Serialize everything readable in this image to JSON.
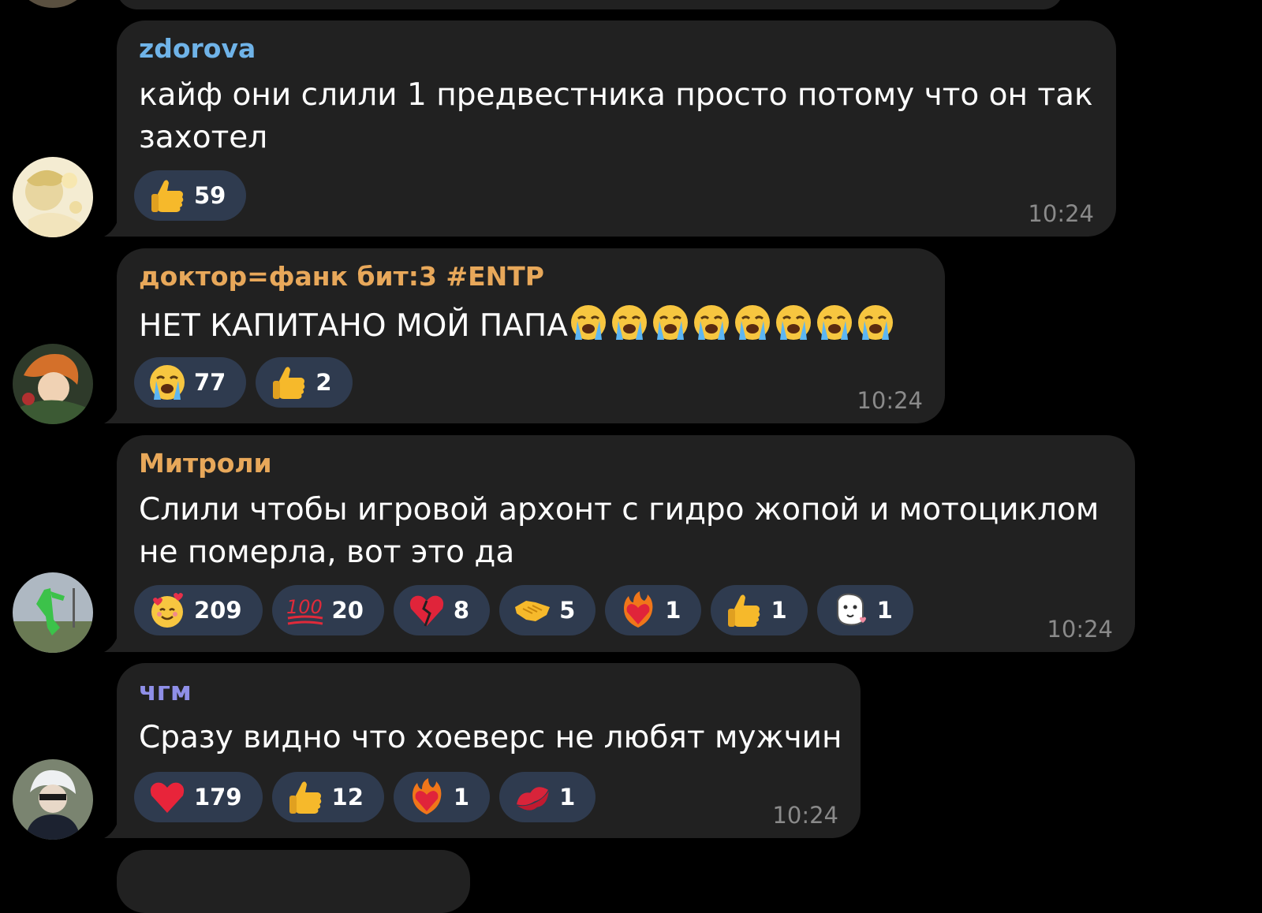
{
  "messages": [
    {
      "author": "zdorova",
      "author_color": "#6fb3e8",
      "lines": [
        "кайф они слили 1 предвестника просто потому что он так",
        "захотел"
      ],
      "reactions": [
        {
          "icon": "thumbs-up-icon",
          "count": "59"
        }
      ],
      "time": "10:24"
    },
    {
      "author": "доктор=фанк бит:3 #ENTP",
      "author_color": "#e8a85a",
      "lines": [
        "НЕТ КАПИТАНО МОЙ ПАПА"
      ],
      "inline_emoji": "loudly-crying-face-icon",
      "reactions": [
        {
          "icon": "loudly-crying-face-icon",
          "count": "77"
        },
        {
          "icon": "thumbs-up-icon",
          "count": "2"
        }
      ],
      "time": "10:24"
    },
    {
      "author": "Митроли",
      "author_color": "#e8a85a",
      "lines": [
        "Слили чтобы игровой архонт с гидро жопой и мотоциклом",
        "не померла, вот это да"
      ],
      "reactions": [
        {
          "icon": "smiling-face-with-hearts-icon",
          "count": "209"
        },
        {
          "icon": "hundred-points-icon",
          "count": "20"
        },
        {
          "icon": "broken-heart-icon",
          "count": "8"
        },
        {
          "icon": "handshake-icon",
          "count": "5"
        },
        {
          "icon": "heart-on-fire-icon",
          "count": "1"
        },
        {
          "icon": "thumbs-up-icon",
          "count": "1"
        },
        {
          "icon": "custom-sticker-icon",
          "count": "1"
        }
      ],
      "time": "10:24"
    },
    {
      "author": "чгм",
      "author_color": "#8f8fe8",
      "lines": [
        "Сразу видно что хоеверс не любят мужчин"
      ],
      "reactions": [
        {
          "icon": "red-heart-icon",
          "count": "179"
        },
        {
          "icon": "thumbs-up-icon",
          "count": "12"
        },
        {
          "icon": "heart-on-fire-icon",
          "count": "1"
        },
        {
          "icon": "kiss-mark-icon",
          "count": "1"
        }
      ],
      "time": "10:24"
    }
  ]
}
